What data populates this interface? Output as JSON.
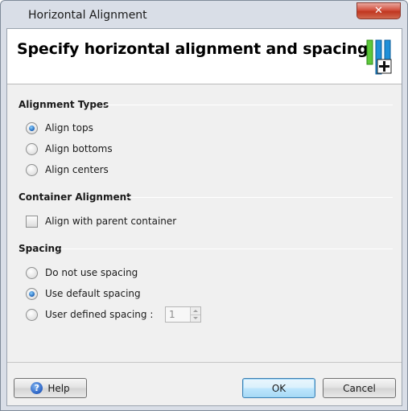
{
  "window": {
    "title": "Horizontal Alignment",
    "close_glyph": "✕"
  },
  "banner": {
    "title": "Specify horizontal alignment and spacing",
    "icon": "horizontal-align-add-icon"
  },
  "alignment_types": {
    "title": "Alignment Types",
    "options": [
      {
        "label": "Align tops",
        "selected": true
      },
      {
        "label": "Align bottoms",
        "selected": false
      },
      {
        "label": "Align centers",
        "selected": false
      }
    ]
  },
  "container_alignment": {
    "title": "Container Alignment",
    "checkbox_label": "Align with parent container",
    "checked": false
  },
  "spacing": {
    "title": "Spacing",
    "options": [
      {
        "label": "Do not use spacing",
        "selected": false
      },
      {
        "label": "Use default spacing",
        "selected": true
      },
      {
        "label": "User defined spacing :",
        "selected": false
      }
    ],
    "spinner_value": "1"
  },
  "buttons": {
    "help": "Help",
    "help_glyph": "?",
    "ok": "OK",
    "cancel": "Cancel"
  },
  "colors": {
    "accent": "#1d63b8",
    "close": "#c0361f",
    "banner_green": "#5cc83a",
    "banner_blue": "#1e8fd8"
  }
}
